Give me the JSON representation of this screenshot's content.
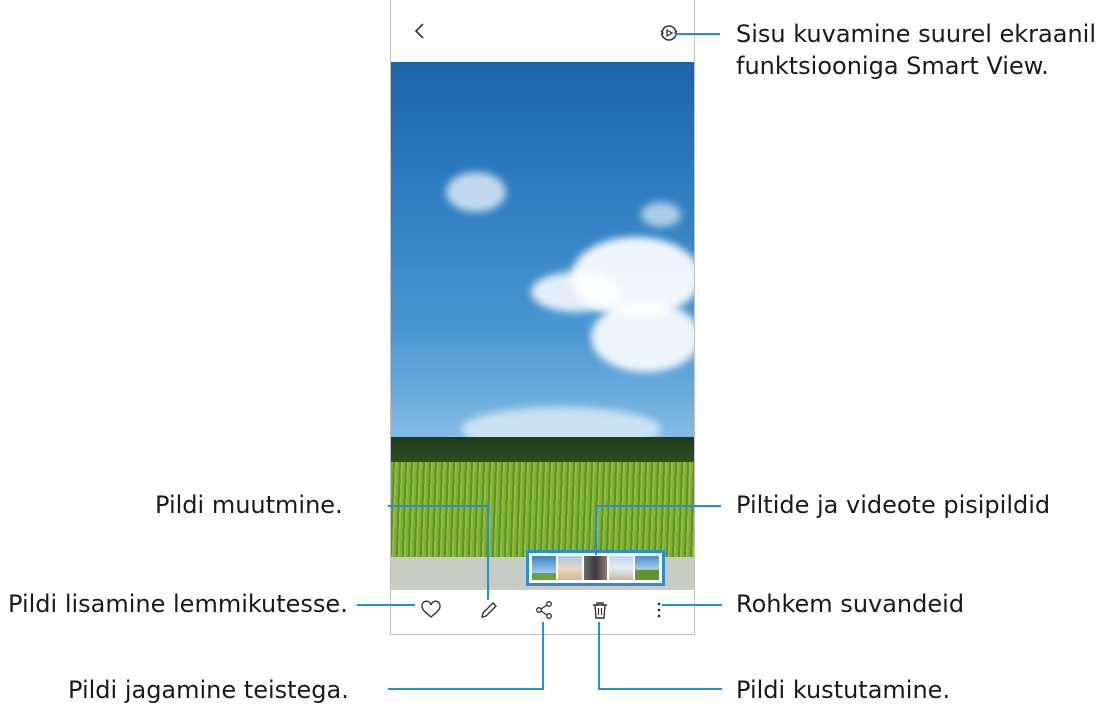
{
  "annotations": {
    "smart_view_line1": "Sisu kuvamine suurel ekraanil",
    "smart_view_line2": "funktsiooniga Smart View.",
    "edit": "Pildi muutmine.",
    "thumbnails": "Piltide ja videote pisipildid",
    "favourite": "Pildi lisamine lemmikutesse.",
    "more": "Rohkem suvandeid",
    "share": "Pildi jagamine teistega.",
    "delete": "Pildi kustutamine."
  },
  "icons": {
    "back": "chevron-left-icon",
    "smart_view": "smart-view-icon",
    "favourite": "heart-icon",
    "edit": "pencil-icon",
    "share": "share-icon",
    "delete": "trash-icon",
    "more": "more-vertical-icon"
  },
  "thumbnails": [
    {
      "name": "thumbnail-sky"
    },
    {
      "name": "thumbnail-beach"
    },
    {
      "name": "thumbnail-people"
    },
    {
      "name": "thumbnail-person"
    },
    {
      "name": "thumbnail-field"
    }
  ],
  "colors": {
    "accent": "#2a8fd0"
  }
}
